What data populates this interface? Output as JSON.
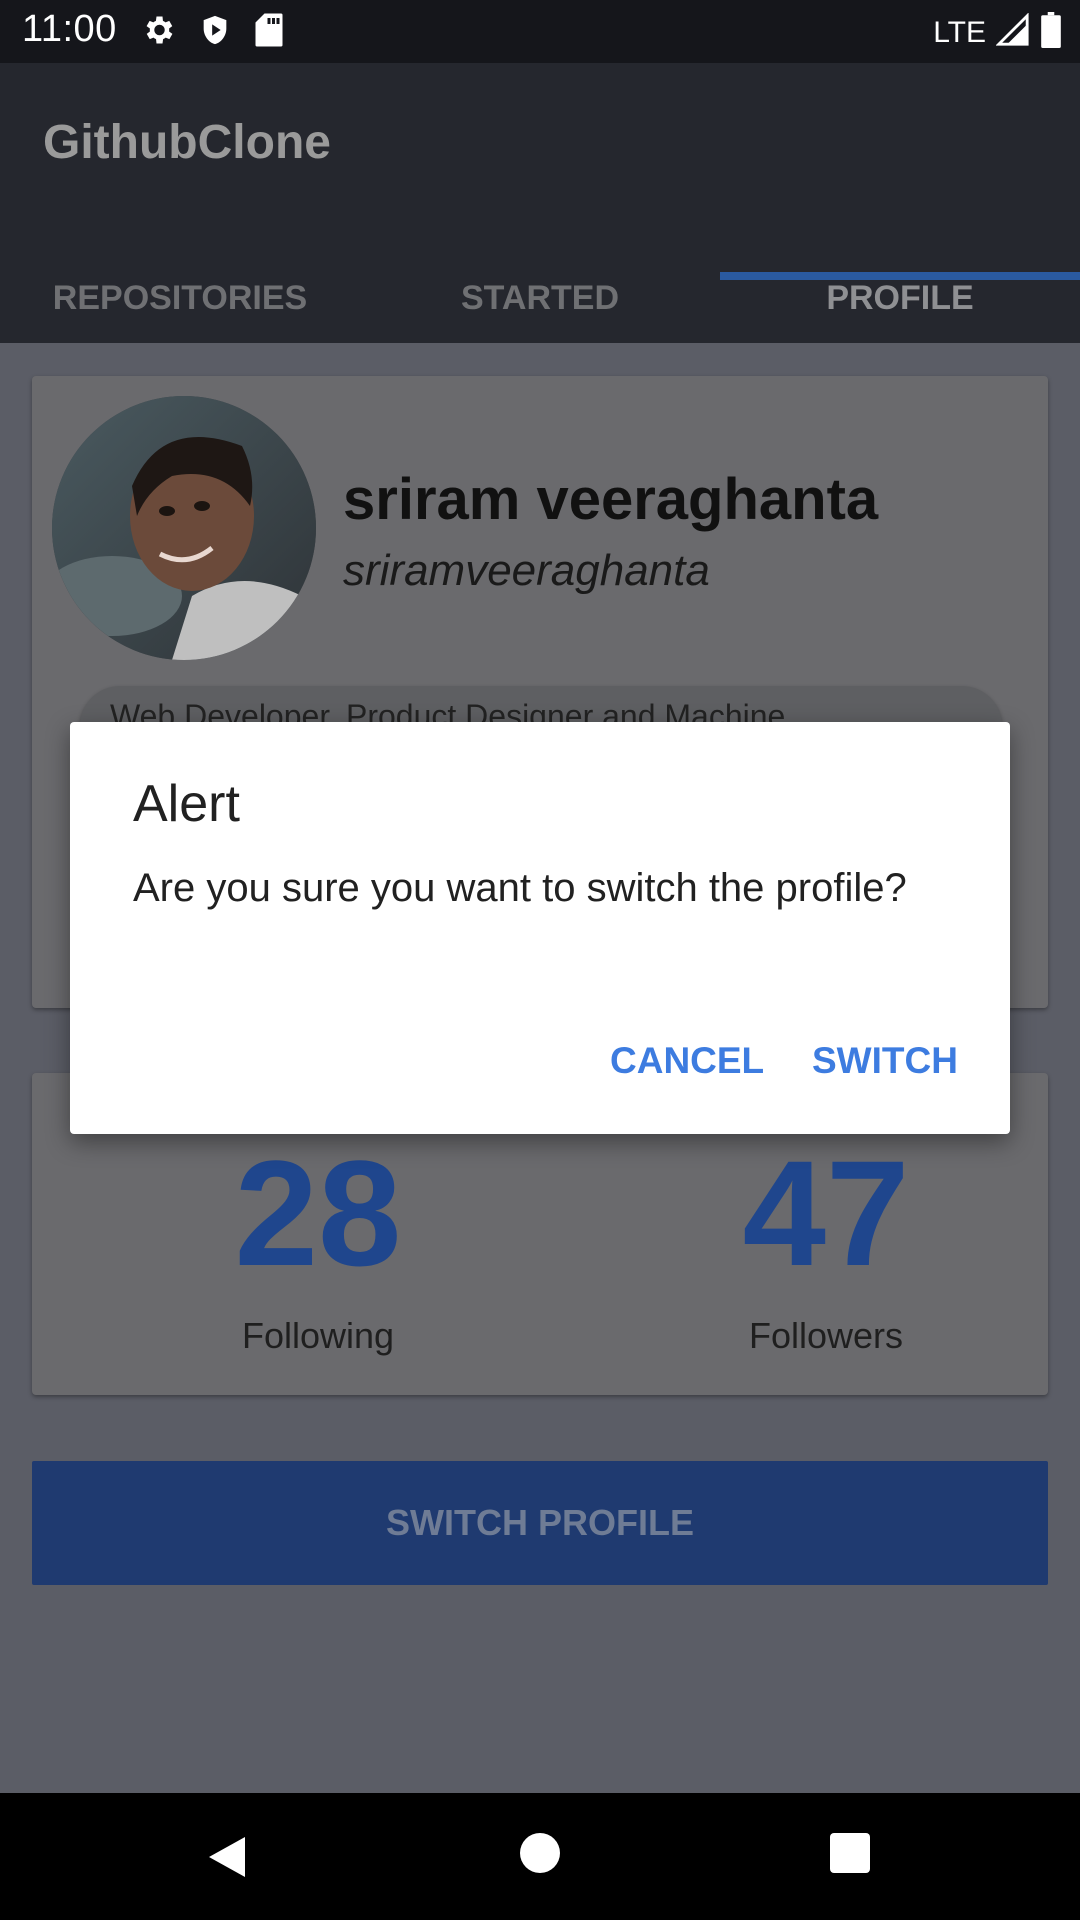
{
  "status_bar": {
    "time": "11:00",
    "network": "LTE"
  },
  "app_bar": {
    "title": "GithubClone"
  },
  "tabs": [
    {
      "label": "REPOSITORIES"
    },
    {
      "label": "STARTED"
    },
    {
      "label": "PROFILE"
    }
  ],
  "profile": {
    "name": "sriram veeraghanta",
    "login": "sriramveeraghanta",
    "bio": "Web Developer, Product Designer and Machine",
    "following": "28",
    "following_label": "Following",
    "followers": "47",
    "followers_label": "Followers",
    "switch_button": "SWITCH PROFILE"
  },
  "dialog": {
    "title": "Alert",
    "message": "Are you sure you want to switch the profile?",
    "cancel": "CANCEL",
    "confirm": "SWITCH"
  },
  "colors": {
    "accent": "#3d7ce0",
    "tab_indicator": "#2a5aa0",
    "stat_number": "#1f468d",
    "button": "#1f3a70"
  }
}
